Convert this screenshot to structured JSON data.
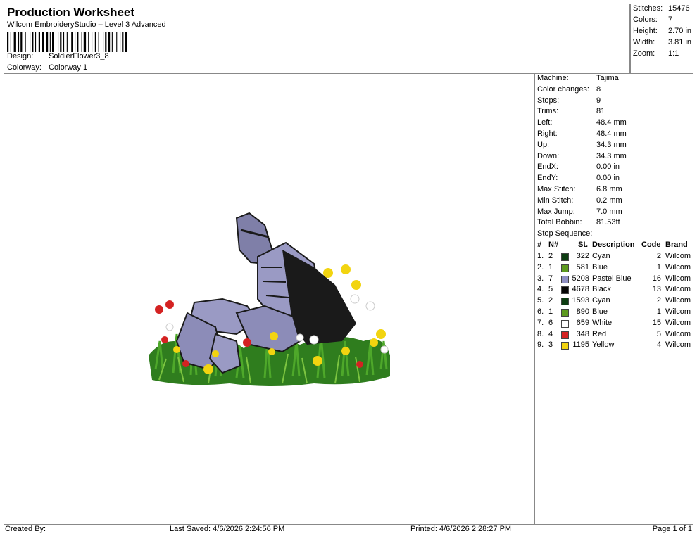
{
  "header": {
    "title": "Production Worksheet",
    "subtitle": "Wilcom EmbroideryStudio – Level 3 Advanced",
    "design_label": "Design:",
    "design_value": "SoldierFlower3_8",
    "colorway_label": "Colorway:",
    "colorway_value": "Colorway 1"
  },
  "summary": [
    {
      "label": "Stitches:",
      "value": "15476"
    },
    {
      "label": "Colors:",
      "value": "7"
    },
    {
      "label": "Height:",
      "value": "2.70 in"
    },
    {
      "label": "Width:",
      "value": "3.81 in"
    },
    {
      "label": "Zoom:",
      "value": "1:1"
    }
  ],
  "info": [
    {
      "label": "Machine:",
      "value": "Tajima"
    },
    {
      "label": "Color changes:",
      "value": "8"
    },
    {
      "label": "Stops:",
      "value": "9"
    },
    {
      "label": "Trims:",
      "value": "81"
    },
    {
      "label": "Left:",
      "value": "48.4 mm"
    },
    {
      "label": "Right:",
      "value": "48.4 mm"
    },
    {
      "label": "Up:",
      "value": "34.3 mm"
    },
    {
      "label": "Down:",
      "value": "34.3 mm"
    },
    {
      "label": "EndX:",
      "value": "0.00 in"
    },
    {
      "label": "EndY:",
      "value": "0.00 in"
    },
    {
      "label": "Max Stitch:",
      "value": "6.8 mm"
    },
    {
      "label": "Min Stitch:",
      "value": "0.2 mm"
    },
    {
      "label": "Max Jump:",
      "value": "7.0 mm"
    },
    {
      "label": "Total Bobbin:",
      "value": "81.53ft"
    }
  ],
  "stop_sequence": {
    "label": "Stop Sequence:",
    "headers": {
      "num": "#",
      "n": "N#",
      "st": "St.",
      "desc": "Description",
      "code": "Code",
      "brand": "Brand"
    },
    "rows": [
      {
        "num": "1.",
        "n": "2",
        "color": "#0d3d12",
        "st": "322",
        "desc": "Cyan",
        "code": "2",
        "brand": "Wilcom"
      },
      {
        "num": "2.",
        "n": "1",
        "color": "#5d9a1f",
        "st": "581",
        "desc": "Blue",
        "code": "1",
        "brand": "Wilcom"
      },
      {
        "num": "3.",
        "n": "7",
        "color": "#8f8fc2",
        "st": "5208",
        "desc": "Pastel Blue",
        "code": "16",
        "brand": "Wilcom"
      },
      {
        "num": "4.",
        "n": "5",
        "color": "#050505",
        "st": "4678",
        "desc": "Black",
        "code": "13",
        "brand": "Wilcom"
      },
      {
        "num": "5.",
        "n": "2",
        "color": "#0d3d12",
        "st": "1593",
        "desc": "Cyan",
        "code": "2",
        "brand": "Wilcom"
      },
      {
        "num": "6.",
        "n": "1",
        "color": "#5d9a1f",
        "st": "890",
        "desc": "Blue",
        "code": "1",
        "brand": "Wilcom"
      },
      {
        "num": "7.",
        "n": "6",
        "color": "#ffffff",
        "st": "659",
        "desc": "White",
        "code": "15",
        "brand": "Wilcom"
      },
      {
        "num": "8.",
        "n": "4",
        "color": "#d42222",
        "st": "348",
        "desc": "Red",
        "code": "5",
        "brand": "Wilcom"
      },
      {
        "num": "9.",
        "n": "3",
        "color": "#f2d410",
        "st": "1195",
        "desc": "Yellow",
        "code": "4",
        "brand": "Wilcom"
      }
    ]
  },
  "footer": {
    "created_by": "Created By:",
    "last_saved": "Last Saved: 4/6/2026 2:24:56 PM",
    "printed": "Printed: 4/6/2026 2:28:27 PM",
    "page": "Page 1 of 1"
  }
}
